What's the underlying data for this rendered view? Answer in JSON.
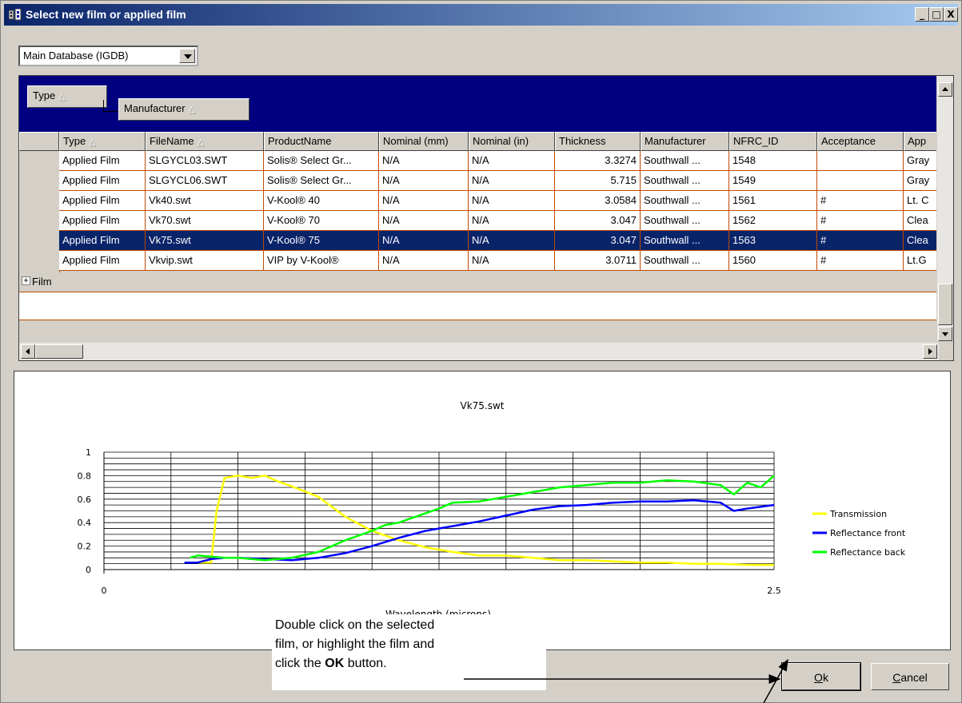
{
  "window": {
    "title": "Select new film or applied film",
    "controls": [
      "_",
      "□",
      "X"
    ]
  },
  "database_select": {
    "value": "Main Database (IGDB)"
  },
  "group_by": [
    {
      "label": "Type",
      "sort": "ascending"
    },
    {
      "label": "Manufacturer",
      "sort": "ascending"
    }
  ],
  "columns": [
    {
      "label": "Type",
      "sort": "ascending"
    },
    {
      "label": "FileName",
      "sort": "ascending"
    },
    {
      "label": "ProductName"
    },
    {
      "label": "Nominal (mm)"
    },
    {
      "label": "Nominal (in)"
    },
    {
      "label": "Thickness"
    },
    {
      "label": "Manufacturer"
    },
    {
      "label": "NFRC_ID"
    },
    {
      "label": "Acceptance"
    },
    {
      "label": "App"
    }
  ],
  "rows": [
    [
      "Applied Film",
      "SLGYCL03.SWT",
      "Solis® Select Gr...",
      "N/A",
      "N/A",
      "3.3274",
      "Southwall ...",
      "1548",
      "",
      "Gray"
    ],
    [
      "Applied Film",
      "SLGYCL06.SWT",
      "Solis® Select Gr...",
      "N/A",
      "N/A",
      "5.715",
      "Southwall ...",
      "1549",
      "",
      "Gray"
    ],
    [
      "Applied Film",
      "Vk40.swt",
      "V-Kool® 40",
      "N/A",
      "N/A",
      "3.0584",
      "Southwall ...",
      "1561",
      "#",
      "Lt. C"
    ],
    [
      "Applied Film",
      "Vk70.swt",
      "V-Kool® 70",
      "N/A",
      "N/A",
      "3.047",
      "Southwall ...",
      "1562",
      "#",
      "Clea"
    ],
    [
      "Applied Film",
      "Vk75.swt",
      "V-Kool® 75",
      "N/A",
      "N/A",
      "3.047",
      "Southwall ...",
      "1563",
      "#",
      "Clea"
    ],
    [
      "Applied Film",
      "Vkvip.swt",
      "VIP by V-Kool®",
      "N/A",
      "N/A",
      "3.0711",
      "Southwall ...",
      "1560",
      "#",
      "Lt.G"
    ]
  ],
  "selected_row": 4,
  "group_row": {
    "expander": "+",
    "label": "Film"
  },
  "chart_data": {
    "type": "line",
    "title": "Vk75.swt",
    "xlabel": "Wavelength (microns)",
    "ylabel": "",
    "xlim": [
      0,
      2.5
    ],
    "ylim": [
      0,
      1
    ],
    "x_ticks": [
      "0",
      "2.5"
    ],
    "y_ticks": [
      "0",
      "0.2",
      "0.4",
      "0.6",
      "0.8",
      "1"
    ],
    "grid": true,
    "legend_position": "right",
    "series": [
      {
        "name": "Transmission",
        "color": "#ffff00",
        "x": [
          0.3,
          0.35,
          0.4,
          0.42,
          0.45,
          0.5,
          0.55,
          0.6,
          0.65,
          0.7,
          0.8,
          0.9,
          1.0,
          1.1,
          1.2,
          1.3,
          1.4,
          1.5,
          1.6,
          1.7,
          1.8,
          1.9,
          2.0,
          2.1,
          2.2,
          2.3,
          2.4,
          2.5
        ],
        "y": [
          0.06,
          0.06,
          0.06,
          0.5,
          0.78,
          0.8,
          0.78,
          0.8,
          0.75,
          0.71,
          0.62,
          0.45,
          0.33,
          0.25,
          0.19,
          0.15,
          0.12,
          0.12,
          0.1,
          0.08,
          0.08,
          0.07,
          0.06,
          0.06,
          0.05,
          0.05,
          0.04,
          0.04
        ]
      },
      {
        "name": "Reflectance front",
        "color": "#0000ff",
        "x": [
          0.3,
          0.35,
          0.4,
          0.45,
          0.5,
          0.6,
          0.7,
          0.8,
          0.9,
          1.0,
          1.1,
          1.2,
          1.3,
          1.4,
          1.5,
          1.6,
          1.7,
          1.8,
          1.9,
          2.0,
          2.1,
          2.2,
          2.3,
          2.35,
          2.4,
          2.5
        ],
        "y": [
          0.06,
          0.06,
          0.09,
          0.1,
          0.1,
          0.09,
          0.08,
          0.1,
          0.14,
          0.2,
          0.27,
          0.33,
          0.37,
          0.41,
          0.46,
          0.51,
          0.54,
          0.55,
          0.57,
          0.58,
          0.58,
          0.59,
          0.57,
          0.5,
          0.52,
          0.55
        ]
      },
      {
        "name": "Reflectance back",
        "color": "#00ff00",
        "x": [
          0.32,
          0.35,
          0.4,
          0.45,
          0.5,
          0.6,
          0.7,
          0.8,
          0.9,
          1.0,
          1.05,
          1.1,
          1.2,
          1.25,
          1.3,
          1.4,
          1.5,
          1.6,
          1.7,
          1.8,
          1.9,
          2.0,
          2.1,
          2.2,
          2.3,
          2.35,
          2.4,
          2.45,
          2.5
        ],
        "y": [
          0.1,
          0.12,
          0.11,
          0.1,
          0.1,
          0.08,
          0.1,
          0.15,
          0.25,
          0.33,
          0.38,
          0.4,
          0.48,
          0.52,
          0.57,
          0.58,
          0.62,
          0.66,
          0.7,
          0.72,
          0.74,
          0.74,
          0.76,
          0.75,
          0.72,
          0.64,
          0.74,
          0.7,
          0.8
        ]
      }
    ]
  },
  "callout": {
    "line1": "Double click on the selected",
    "line2": "film, or highlight the film and",
    "line3_prefix": "click the ",
    "line3_bold": "OK",
    "line3_suffix": " button."
  },
  "buttons": {
    "ok": {
      "mnemonic": "O",
      "rest": "k"
    },
    "cancel": {
      "mnemonic": "C",
      "rest": "ancel"
    }
  }
}
